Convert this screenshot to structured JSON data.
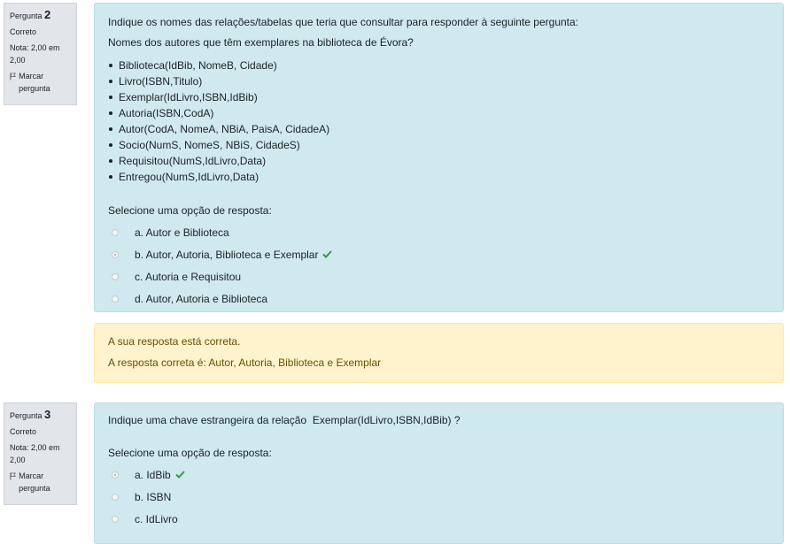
{
  "questions": [
    {
      "label": "Pergunta",
      "number": "2",
      "state": "Correto",
      "grade": "Nota: 2,00 em 2,00",
      "flag_label": "Marcar pergunta",
      "text": "Indique os nomes das relações/tabelas que teria que consultar para responder à seguinte pergunta:",
      "text2": "Nomes dos autores que têm exemplares na biblioteca de Évora?",
      "relations": [
        "Biblioteca(IdBib, NomeB, Cidade)",
        "Livro(ISBN,Titulo)",
        "Exemplar(IdLivro,ISBN,IdBib)",
        "Autoria(ISBN,CodA)",
        "Autor(CodA, NomeA, NBiA, PaisA, CidadeA)",
        "Socio(NumS, NomeS, NBiS, CidadeS)",
        "Requisitou(NumS,IdLivro,Data)",
        "Entregou(NumS,IdLivro,Data)"
      ],
      "prompt": "Selecione uma opção de resposta:",
      "options": [
        {
          "label": "a. Autor e Biblioteca",
          "selected": false,
          "correct": false
        },
        {
          "label": "b. Autor, Autoria, Biblioteca e Exemplar",
          "selected": true,
          "correct": true
        },
        {
          "label": "c. Autoria e Requisitou",
          "selected": false,
          "correct": false
        },
        {
          "label": "d. Autor, Autoria e Biblioteca",
          "selected": false,
          "correct": false
        }
      ],
      "feedback": {
        "line1": "A sua resposta está correta.",
        "line2": "A resposta correta é: Autor, Autoria, Biblioteca e Exemplar"
      }
    },
    {
      "label": "Pergunta",
      "number": "3",
      "state": "Correto",
      "grade": "Nota: 2,00 em 2,00",
      "flag_label": "Marcar pergunta",
      "text": "Indique uma chave estrangeira da relação  Exemplar(IdLivro,ISBN,IdBib) ?",
      "prompt": "Selecione uma opção de resposta:",
      "options": [
        {
          "label": "a. IdBib",
          "selected": true,
          "correct": true
        },
        {
          "label": "b. ISBN",
          "selected": false,
          "correct": false
        },
        {
          "label": "c. IdLivro",
          "selected": false,
          "correct": false
        }
      ]
    }
  ],
  "colors": {
    "content_bg": "#cfe9ee",
    "feedback_bg": "#fff3cd",
    "check": "#2e9e3f"
  }
}
